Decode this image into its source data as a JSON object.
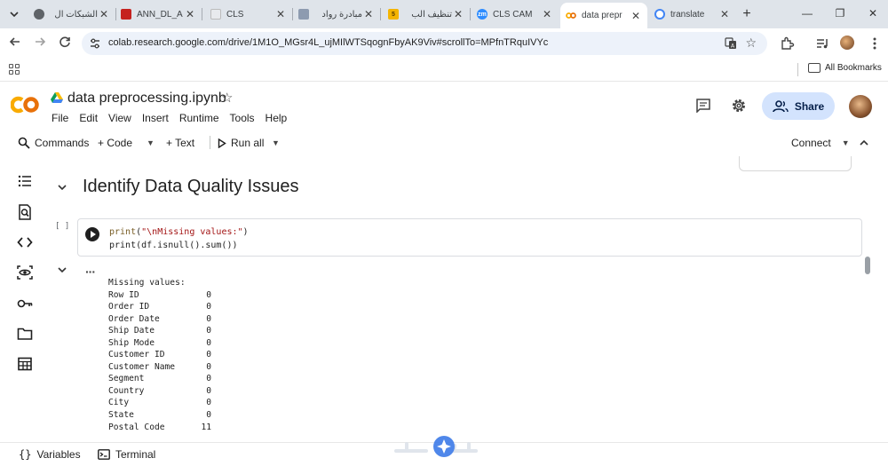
{
  "browser": {
    "tabs": [
      {
        "title": "الشبكات ال",
        "favicon": "globe-icon"
      },
      {
        "title": "ANN_DL_A",
        "favicon": "pdf-icon"
      },
      {
        "title": "CLS",
        "favicon": "doc-icon"
      },
      {
        "title": "مبادرة رواد",
        "favicon": "person-icon"
      },
      {
        "title": "تنظيف الب",
        "favicon": "five-icon"
      },
      {
        "title": "CLS CAM",
        "favicon": "zoom-icon"
      },
      {
        "title": "data prepr",
        "favicon": "colab-icon"
      },
      {
        "title": "translate",
        "favicon": "google-icon"
      }
    ],
    "active_tab_index": 6,
    "url": "colab.research.google.com/drive/1M1O_MGsr4L_ujMIlWTSqognFbyAK9Viv#scrollTo=MPfnTRquIVYc",
    "bookmarks_label": "All Bookmarks",
    "tab_close_glyph": "✕",
    "new_tab_glyph": "+",
    "window_controls": {
      "minimize": "—",
      "maximize": "❐",
      "close": "✕"
    }
  },
  "colab": {
    "notebook_title": "data preprocessing.ipynb",
    "menu": [
      "File",
      "Edit",
      "View",
      "Insert",
      "Runtime",
      "Tools",
      "Help"
    ],
    "share_label": "Share",
    "toolbar": {
      "commands": "Commands",
      "add_code": "+ Code",
      "add_text": "+ Text",
      "run_all": "Run all",
      "connect": "Connect"
    },
    "section_heading": "Identify Data Quality Issues",
    "cell": {
      "execution_count": "[ ]",
      "code_lines": [
        {
          "fn": "print",
          "open": "(",
          "str": "\"\\nMissing values:\"",
          "close": ")"
        },
        {
          "plain": "print(df.isnull().sum())"
        }
      ]
    },
    "output": {
      "title": "Missing values:",
      "rows": [
        {
          "name": "Row ID",
          "value": "0"
        },
        {
          "name": "Order ID",
          "value": "0"
        },
        {
          "name": "Order Date",
          "value": "0"
        },
        {
          "name": "Ship Date",
          "value": "0"
        },
        {
          "name": "Ship Mode",
          "value": "0"
        },
        {
          "name": "Customer ID",
          "value": "0"
        },
        {
          "name": "Customer Name",
          "value": "0"
        },
        {
          "name": "Segment",
          "value": "0"
        },
        {
          "name": "Country",
          "value": "0"
        },
        {
          "name": "City",
          "value": "0"
        },
        {
          "name": "State",
          "value": "0"
        },
        {
          "name": "Postal Code",
          "value": "11"
        }
      ]
    },
    "statusbar": {
      "variables": "Variables",
      "terminal": "Terminal"
    }
  },
  "colors": {
    "tabstrip_bg": "#dfe4ea",
    "omnibox_bg": "#edf2fa",
    "share_bg": "#d3e3fd",
    "colab_orange": "#f9ab00",
    "code_string": "#a31515"
  }
}
